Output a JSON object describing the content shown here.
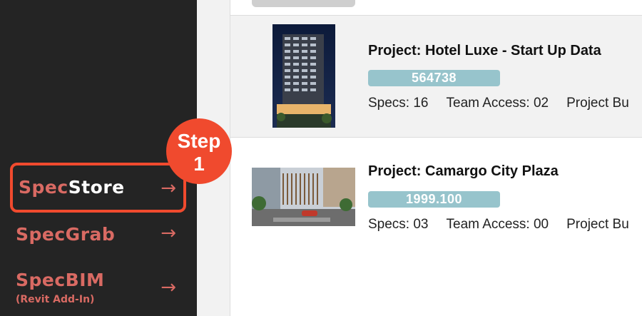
{
  "sidebar": {
    "items": [
      {
        "label_prefix": "Spec",
        "label_suffix": "Store",
        "arrow": "→",
        "subtitle": ""
      },
      {
        "label": "SpecGrab",
        "arrow": "→"
      },
      {
        "label": "SpecBIM",
        "arrow": "→",
        "subtitle": "(Revit Add-In)"
      }
    ]
  },
  "step_badge": {
    "line1": "Step",
    "line2": "1"
  },
  "projects": [
    {
      "title": "Project: Hotel Luxe - Start Up Data",
      "code": "564738",
      "specs": "Specs: 16",
      "team_access": "Team Access: 02",
      "budget_label": "Project Bu"
    },
    {
      "title": "Project: Camargo City Plaza",
      "code": "1999.100",
      "specs": "Specs: 03",
      "team_access": "Team Access: 00",
      "budget_label": "Project Bu"
    }
  ],
  "colors": {
    "sidebar_bg": "#242424",
    "accent_coral": "#d96a63",
    "highlight_red": "#f04a2e",
    "code_pill": "#97c4cc"
  }
}
